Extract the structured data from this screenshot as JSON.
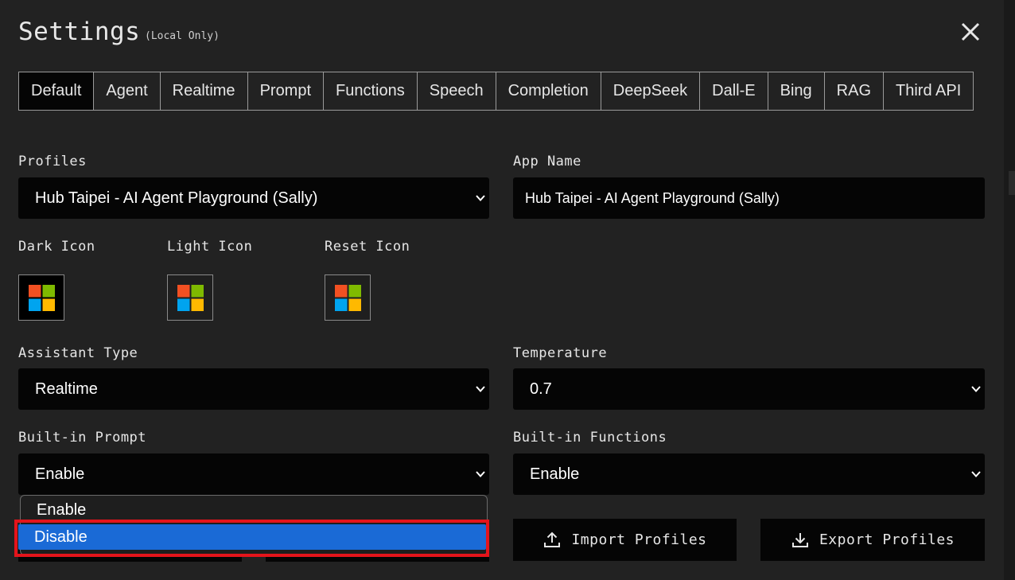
{
  "header": {
    "title": "Settings",
    "subtitle": "(Local Only)",
    "close_icon": "close-icon"
  },
  "tabs": [
    {
      "label": "Default",
      "active": true
    },
    {
      "label": "Agent"
    },
    {
      "label": "Realtime"
    },
    {
      "label": "Prompt"
    },
    {
      "label": "Functions"
    },
    {
      "label": "Speech"
    },
    {
      "label": "Completion"
    },
    {
      "label": "DeepSeek"
    },
    {
      "label": "Dall-E"
    },
    {
      "label": "Bing"
    },
    {
      "label": "RAG"
    },
    {
      "label": "Third API"
    }
  ],
  "profiles": {
    "label": "Profiles",
    "value": "Hub Taipei - AI Agent Playground (Sally)"
  },
  "app_name": {
    "label": "App Name",
    "value": "Hub Taipei - AI Agent Playground (Sally)"
  },
  "icons": {
    "dark_label": "Dark Icon",
    "light_label": "Light Icon",
    "reset_label": "Reset Icon",
    "logo_colors": [
      "#f25022",
      "#7fba00",
      "#00a4ef",
      "#ffb900"
    ]
  },
  "assistant_type": {
    "label": "Assistant Type",
    "value": "Realtime"
  },
  "temperature": {
    "label": "Temperature",
    "value": "0.7"
  },
  "builtin_prompt": {
    "label": "Built-in Prompt",
    "value": "Enable",
    "options": [
      "Enable",
      "Disable"
    ],
    "highlighted": "Disable"
  },
  "builtin_functions": {
    "label": "Built-in Functions",
    "value": "Enable"
  },
  "buttons": {
    "import": "Import Profiles",
    "export": "Export Profiles"
  },
  "colors": {
    "background": "#222222",
    "field": "#050505",
    "accent": "#1a6ad6",
    "highlight_border": "#e4141b"
  }
}
